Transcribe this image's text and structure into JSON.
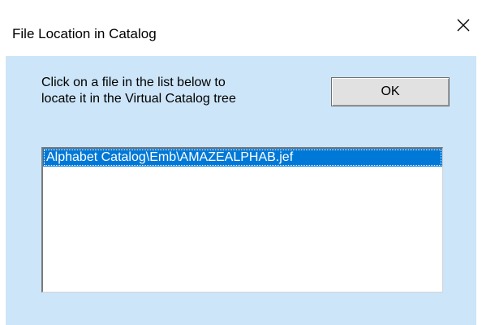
{
  "window": {
    "title": "File Location in Catalog",
    "close_icon": "close-icon"
  },
  "dialog": {
    "instruction": "Click on a file in the list below to\nlocate it in the Virtual Catalog tree",
    "ok_label": "OK"
  },
  "file_list": {
    "items": [
      {
        "label": "Alphabet Catalog\\Emb\\AMAZEALPHAB.jef",
        "selected": true
      }
    ]
  },
  "colors": {
    "client_background": "#cce5f8",
    "selection": "#0078d7",
    "button_face": "#e1e1e1"
  }
}
